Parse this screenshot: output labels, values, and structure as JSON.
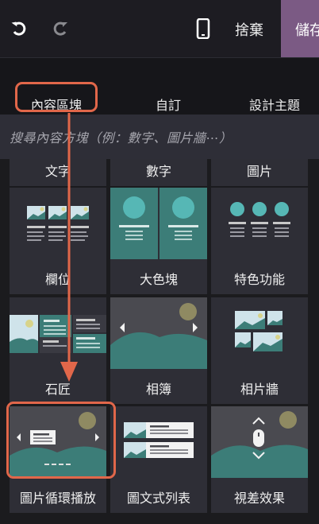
{
  "toolbar": {
    "undo_icon": "undo-icon",
    "redo_icon": "redo-icon",
    "mobile_icon": "mobile-phone-icon",
    "discard_label": "捨棄",
    "save_label": "儲存"
  },
  "tabs": [
    {
      "label": "內容區塊"
    },
    {
      "label": "自訂"
    },
    {
      "label": "設計主題"
    }
  ],
  "search": {
    "placeholder": "搜尋內容方塊（例：數字、圖片牆⋯）"
  },
  "snippets": {
    "row0": [
      "文字",
      "數字",
      "圖片"
    ],
    "row1": [
      "欄位",
      "大色塊",
      "特色功能"
    ],
    "row2": [
      "石匠",
      "相簿",
      "相片牆"
    ],
    "row3": [
      "圖片循環播放",
      "圖文式列表",
      "視差效果"
    ]
  },
  "colors": {
    "accent_highlight": "#e1674a",
    "save_button": "#7b5a84",
    "tile_bg": "#2e2e36",
    "teal": "#3c7d78"
  }
}
